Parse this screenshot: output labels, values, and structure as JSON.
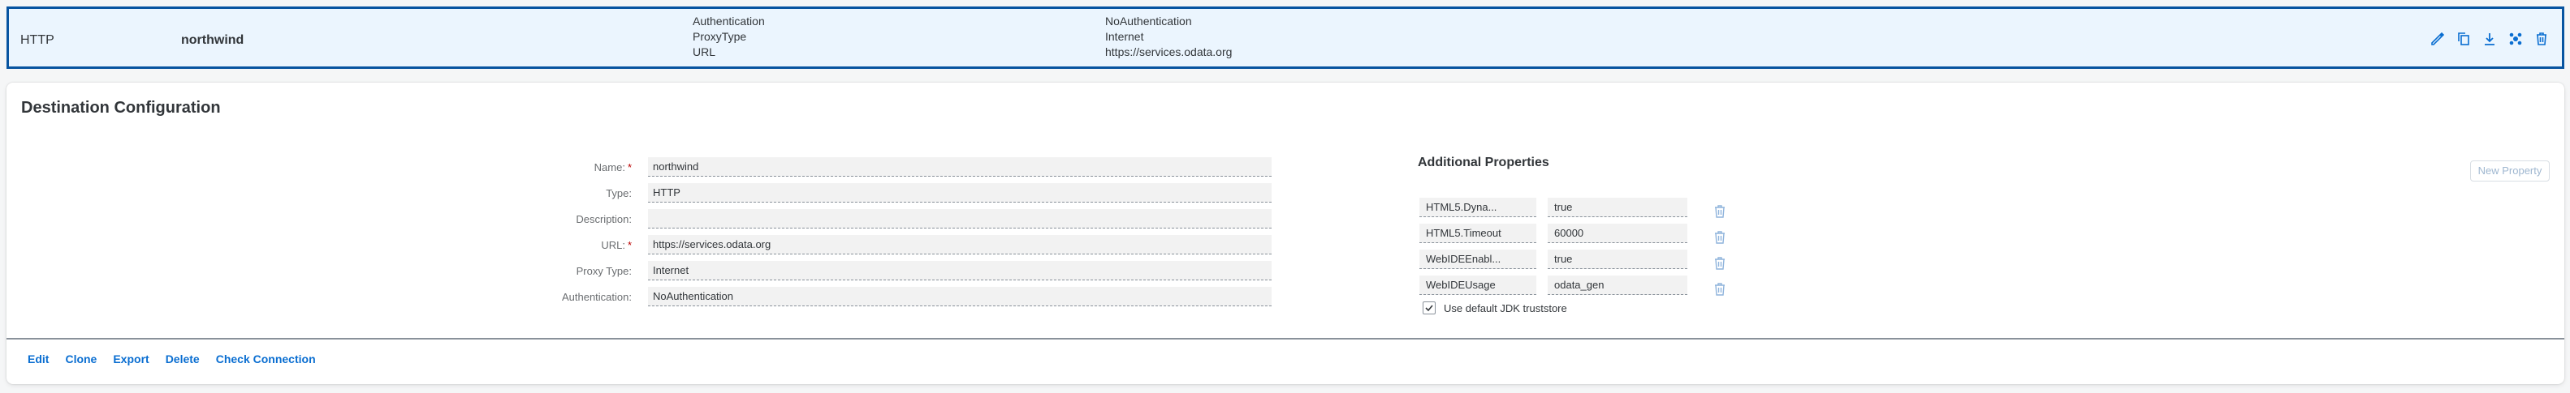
{
  "selected_row": {
    "type": "HTTP",
    "name": "northwind",
    "keys": [
      "Authentication",
      "ProxyType",
      "URL"
    ],
    "values": [
      "NoAuthentication",
      "Internet",
      "https://services.odata.org"
    ],
    "actions": [
      "edit-icon",
      "copy-icon",
      "download-icon",
      "settings-icon",
      "delete-icon"
    ]
  },
  "panel": {
    "title": "Destination Configuration",
    "fields": [
      {
        "label": "Name:",
        "required": true,
        "value": "northwind"
      },
      {
        "label": "Type:",
        "required": false,
        "value": "HTTP"
      },
      {
        "label": "Description:",
        "required": false,
        "value": ""
      },
      {
        "label": "URL:",
        "required": true,
        "value": "https://services.odata.org"
      },
      {
        "label": "Proxy Type:",
        "required": false,
        "value": "Internet"
      },
      {
        "label": "Authentication:",
        "required": false,
        "value": "NoAuthentication"
      }
    ],
    "additional_properties": {
      "title": "Additional Properties",
      "new_property_label": "New Property",
      "properties": [
        {
          "key": "HTML5.Dyna...",
          "value": "true"
        },
        {
          "key": "HTML5.Timeout",
          "value": "60000"
        },
        {
          "key": "WebIDEEnabl...",
          "value": "true"
        },
        {
          "key": "WebIDEUsage",
          "value": "odata_gen"
        }
      ],
      "jdk_checkbox_label": "Use default JDK truststore",
      "jdk_checked": true
    },
    "footer_actions": [
      "Edit",
      "Clone",
      "Export",
      "Delete",
      "Check Connection"
    ]
  },
  "colors": {
    "accent": "#0a6ed1",
    "selected_row_bg": "#ebf5fe",
    "selected_row_border": "#0854a0",
    "required": "#bb0000"
  }
}
